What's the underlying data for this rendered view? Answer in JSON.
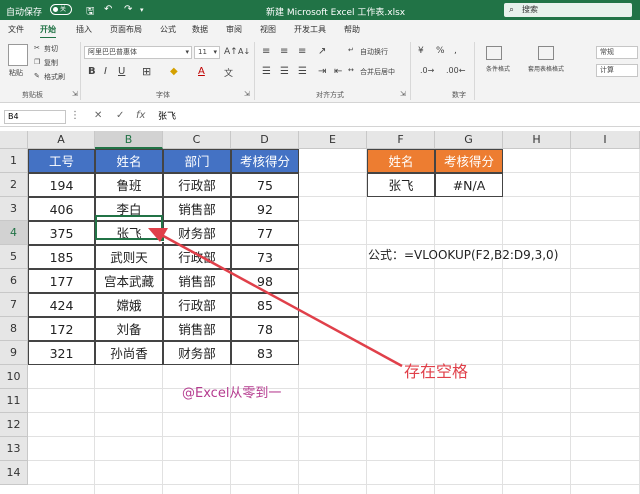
{
  "window": {
    "autosave_label": "自动保存",
    "toggle_label": "关",
    "title": "新建 Microsoft Excel 工作表.xlsx",
    "search_placeholder": "搜索"
  },
  "tabs": [
    "文件",
    "开始",
    "插入",
    "页面布局",
    "公式",
    "数据",
    "审阅",
    "视图",
    "开发工具",
    "帮助"
  ],
  "active_tab": "开始",
  "ribbon": {
    "paste": "粘贴",
    "cut": "剪切",
    "copy": "复制",
    "format_painter": "格式刷",
    "font_name": "阿里巴巴普惠体",
    "font_size": "11",
    "wrap_text": "自动换行",
    "merge_center": "合并后居中",
    "conditional_format": "条件格式",
    "table_format": "套用表格格式",
    "number_format": "常规",
    "number_sub": "计算",
    "groups": {
      "clipboard": "剪贴板",
      "font": "字体",
      "alignment": "对齐方式",
      "number": "数字"
    }
  },
  "formula_bar": {
    "name_box": "B4",
    "content": "张飞"
  },
  "columns": [
    "A",
    "B",
    "C",
    "D",
    "E",
    "F",
    "G",
    "H",
    "I"
  ],
  "selected_column": "B",
  "rows": [
    "1",
    "2",
    "3",
    "4",
    "5",
    "6",
    "7",
    "8",
    "9",
    "10",
    "11",
    "12",
    "13",
    "14"
  ],
  "selected_row": "4",
  "table": {
    "headers": [
      "工号",
      "姓名",
      "部门",
      "考核得分"
    ],
    "rows": [
      [
        "194",
        "鲁班",
        "行政部",
        "75"
      ],
      [
        "406",
        "李白",
        "销售部",
        "92"
      ],
      [
        "375",
        "张飞",
        "财务部",
        "77"
      ],
      [
        "185",
        "武则天",
        "行政部",
        "73"
      ],
      [
        "177",
        "宫本武藏",
        "销售部",
        "98"
      ],
      [
        "424",
        "嫦娥",
        "行政部",
        "85"
      ],
      [
        "172",
        "刘备",
        "销售部",
        "78"
      ],
      [
        "321",
        "孙尚香",
        "财务部",
        "83"
      ]
    ]
  },
  "lookup": {
    "headers": [
      "姓名",
      "考核得分"
    ],
    "values": [
      "张飞",
      "#N/A"
    ]
  },
  "formula_note": "公式：=VLOOKUP(F2,B2:D9,3,0)",
  "watermark": "@Excel从零到一",
  "callout": "存在空格",
  "colors": {
    "excel_green": "#217346",
    "header_blue": "#4472c4",
    "header_orange": "#ed7d31",
    "arrow_red": "#e0404a",
    "watermark": "#b53b8f"
  }
}
